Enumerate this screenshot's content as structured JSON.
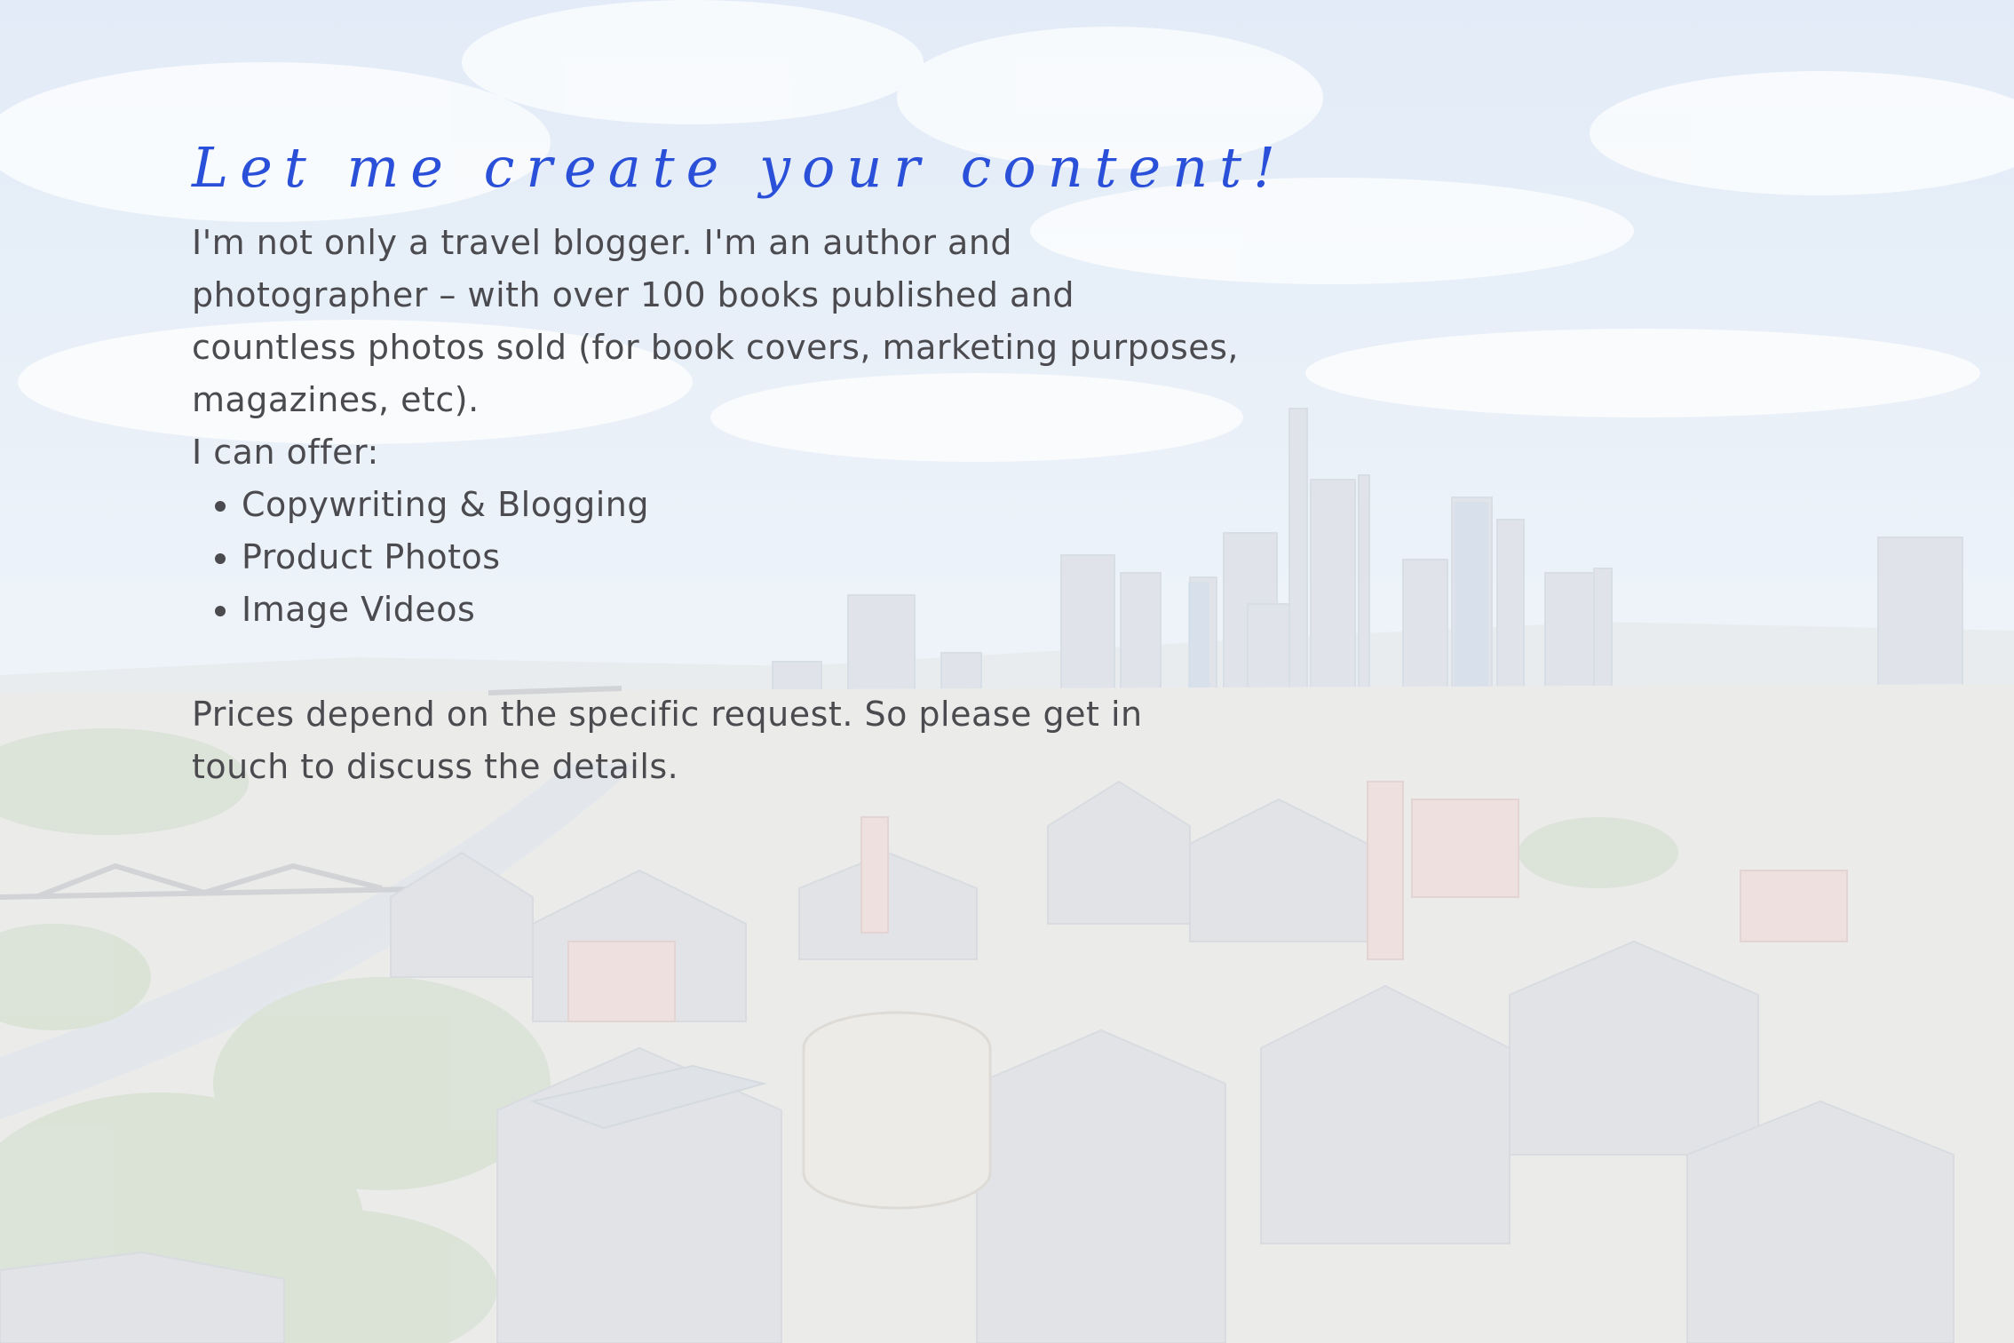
{
  "heading": "Let me create your content!",
  "intro": "I'm not only a travel blogger. I'm an author and photographer – with over 100 books published and countless photos sold (for book covers, marketing purposes, magazines, etc).",
  "offer_label": "I can offer:",
  "offers": [
    "Copywriting & Blogging",
    "Product Photos",
    "Image Videos"
  ],
  "closing": "Prices depend on the specific request. So please get in touch to discuss the details.",
  "colors": {
    "heading": "#2a4fd8",
    "body_text": "#4a4a4f"
  }
}
